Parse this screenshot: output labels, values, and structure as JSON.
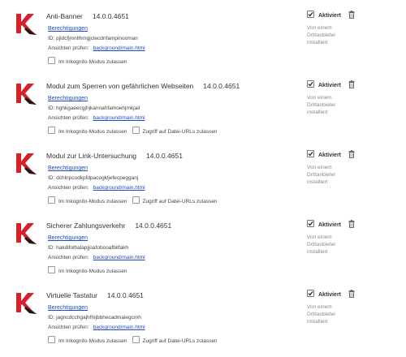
{
  "extensions": [
    {
      "name": "Anti-Banner",
      "version": "14.0.0.4651",
      "permissions_label": "Berechtigungen",
      "id_text": "ID: pjldcfjmnllhmgjclecdnfampinooman",
      "inspect_label": "Ansichten prüfen:",
      "inspect_link": "background/main.html",
      "incognito_label": "Im Inkognito-Modus zulassen",
      "file_urls_label": "",
      "enabled_label": "Aktiviert",
      "note": "Von einem Drittanbieter installiert"
    },
    {
      "name": "Modul zum Sperren von gefährlichen Webseiten",
      "version": "14.0.0.4651",
      "permissions_label": "Berechtigungen",
      "id_text": "ID: hghkgaeecgjhjkannahfamoehjmkjail",
      "inspect_label": "Ansichten prüfen:",
      "inspect_link": "background/main.html",
      "incognito_label": "Im Inkognito-Modus zulassen",
      "file_urls_label": "Zugriff auf Datei-URLs zulassen",
      "enabled_label": "Aktiviert",
      "note": "Von einem Drittanbieter installiert"
    },
    {
      "name": "Modul zur Link-Untersuchung",
      "version": "14.0.0.4651",
      "permissions_label": "Berechtigungen",
      "id_text": "ID: dchlnpcodkpfdpacogkljefecpegganj",
      "inspect_label": "Ansichten prüfen:",
      "inspect_link": "background/main.html",
      "incognito_label": "Im Inkognito-Modus zulassen",
      "file_urls_label": "Zugriff auf Datei-URLs zulassen",
      "enabled_label": "Aktiviert",
      "note": "Von einem Drittanbieter installiert"
    },
    {
      "name": "Sicherer Zahlungsverkehr",
      "version": "14.0.0.4651",
      "permissions_label": "Berechtigungen",
      "id_text": "ID: hakdifolhalapjjoafobooafbilfakh",
      "inspect_label": "Ansichten prüfen:",
      "inspect_link": "background/main.html",
      "incognito_label": "Im Inkognito-Modus zulassen",
      "file_urls_label": "",
      "enabled_label": "Aktiviert",
      "note": "Von einem Drittanbieter installiert"
    },
    {
      "name": "Virtuelle Tastatur",
      "version": "14.0.0.4651",
      "permissions_label": "Berechtigungen",
      "id_text": "ID: jagncdcchgajhfhijbbhecadmaiegcmh",
      "inspect_label": "Ansichten prüfen:",
      "inspect_link": "background/main.html",
      "incognito_label": "Im Inkognito-Modus zulassen",
      "file_urls_label": "Zugriff auf Datei-URLs zulassen",
      "enabled_label": "Aktiviert",
      "note": "Von einem Drittanbieter installiert"
    }
  ],
  "icons": {
    "logo": "kaspersky-k-logo",
    "enabled_checkbox": "checkbox-checked-icon",
    "delete": "trash-icon"
  },
  "colors": {
    "link": "#1a4dc7",
    "logo_red": "#d6202a",
    "logo_dark": "#1a1a1a",
    "muted": "#8a8a8a"
  }
}
